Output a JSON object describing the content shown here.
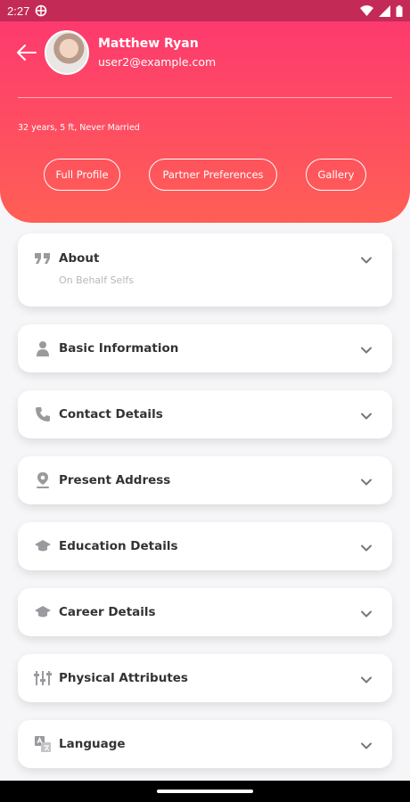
{
  "status_bar": {
    "time": "2:27"
  },
  "header": {
    "user_name": "Matthew Ryan",
    "user_email": "user2@example.com",
    "summary": "32 years, 5 ft, Never Married",
    "buttons": [
      "Full Profile",
      "Partner Preferences",
      "Gallery"
    ]
  },
  "sections": [
    {
      "title": "About",
      "subtitle": "On Behalf Selfs",
      "icon": "quote-icon"
    },
    {
      "title": "Basic Information",
      "icon": "person-icon"
    },
    {
      "title": "Contact Details",
      "icon": "phone-icon"
    },
    {
      "title": "Present Address",
      "icon": "location-icon"
    },
    {
      "title": "Education Details",
      "icon": "graduation-cap-icon"
    },
    {
      "title": "Career Details",
      "icon": "graduation-cap-icon"
    },
    {
      "title": "Physical Attributes",
      "icon": "attributes-icon"
    },
    {
      "title": "Language",
      "icon": "translate-icon"
    }
  ],
  "colors": {
    "header_gradient_top": "#fd3a6e",
    "header_gradient_bottom": "#ff5f55",
    "status_bar": "#c42a56"
  }
}
